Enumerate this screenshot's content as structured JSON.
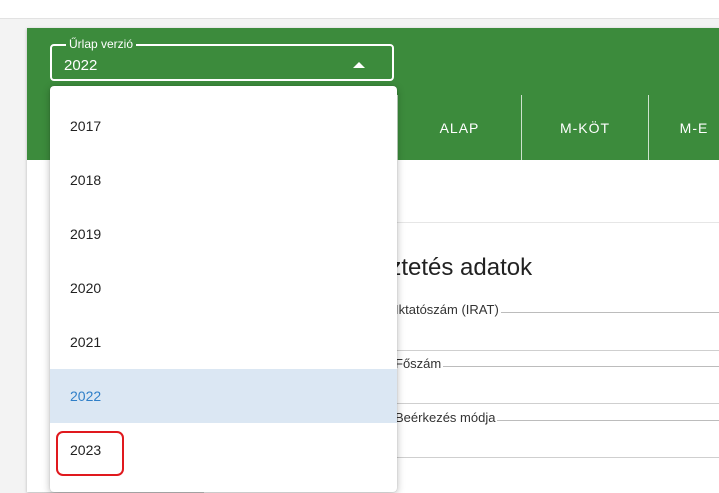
{
  "form": {
    "select_label": "Űrlap verzió",
    "select_value": "2022",
    "tabs": [
      {
        "label": "ALAP"
      },
      {
        "label": "M-KÖT"
      },
      {
        "label": "M-E"
      }
    ]
  },
  "section": {
    "title": "Érkeztetés adatok",
    "title_visible": "rkeztetés adatok",
    "fields": [
      {
        "label": "Iktatószám (IRAT)"
      },
      {
        "label": "Főszám"
      },
      {
        "label": "Beérkezés módja"
      }
    ]
  },
  "dropdown": {
    "options": [
      "2017",
      "2018",
      "2019",
      "2020",
      "2021",
      "2022",
      "2023"
    ],
    "selected": "2022",
    "highlighted_option": "2023"
  },
  "colors": {
    "header_green": "#3c8b3c",
    "selected_bg": "#dbe7f3",
    "selected_text": "#2f7fc8",
    "annotation_red": "#e0191e"
  },
  "icons": {
    "select_arrow": "triangle-up-icon"
  }
}
